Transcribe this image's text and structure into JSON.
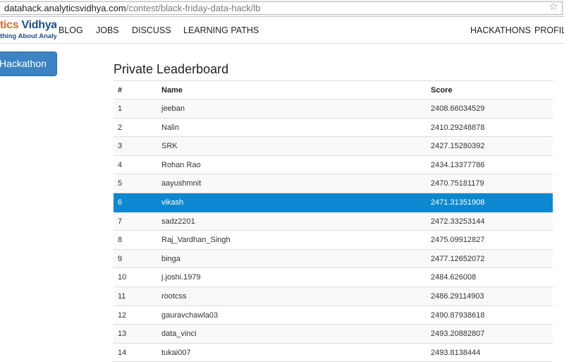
{
  "browser": {
    "url_host": "datahack.analyticsvidhya.com",
    "url_path": "/contest/black-friday-data-hack/lb"
  },
  "logo": {
    "part1": "tics ",
    "part2": "Vidhya",
    "tagline": "thing About Analytics"
  },
  "nav": {
    "blog": "BLOG",
    "jobs": "JOBS",
    "discuss": "DISCUSS",
    "learning_paths": "LEARNING PATHS",
    "hackathons": "HACKATHONS",
    "profile": "PROFILE"
  },
  "sidebar": {
    "button": "Hackathon"
  },
  "leaderboard": {
    "title": "Private Leaderboard",
    "columns": {
      "rank": "#",
      "name": "Name",
      "score": "Score"
    },
    "highlight_color": "#0d88d0",
    "rows": [
      {
        "rank": "1",
        "name": "jeeban",
        "score": "2408.66034529"
      },
      {
        "rank": "2",
        "name": "Nalin",
        "score": "2410.29248878"
      },
      {
        "rank": "3",
        "name": "SRK",
        "score": "2427.15280392"
      },
      {
        "rank": "4",
        "name": "Rohan Rao",
        "score": "2434.13377786"
      },
      {
        "rank": "5",
        "name": "aayushmnit",
        "score": "2470.75181179"
      },
      {
        "rank": "6",
        "name": "vikash",
        "score": "2471.31351908"
      },
      {
        "rank": "7",
        "name": "sadz2201",
        "score": "2472.33253144"
      },
      {
        "rank": "8",
        "name": "Raj_Vardhan_Singh",
        "score": "2475.09912827"
      },
      {
        "rank": "9",
        "name": "binga",
        "score": "2477.12652072"
      },
      {
        "rank": "10",
        "name": "j.joshi.1979",
        "score": "2484.626008"
      },
      {
        "rank": "11",
        "name": "rootcss",
        "score": "2486.29114903"
      },
      {
        "rank": "12",
        "name": "gauravchawla03",
        "score": "2490.87938618"
      },
      {
        "rank": "13",
        "name": "data_vinci",
        "score": "2493.20882807"
      },
      {
        "rank": "14",
        "name": "tukai007",
        "score": "2493.8138444"
      }
    ]
  }
}
